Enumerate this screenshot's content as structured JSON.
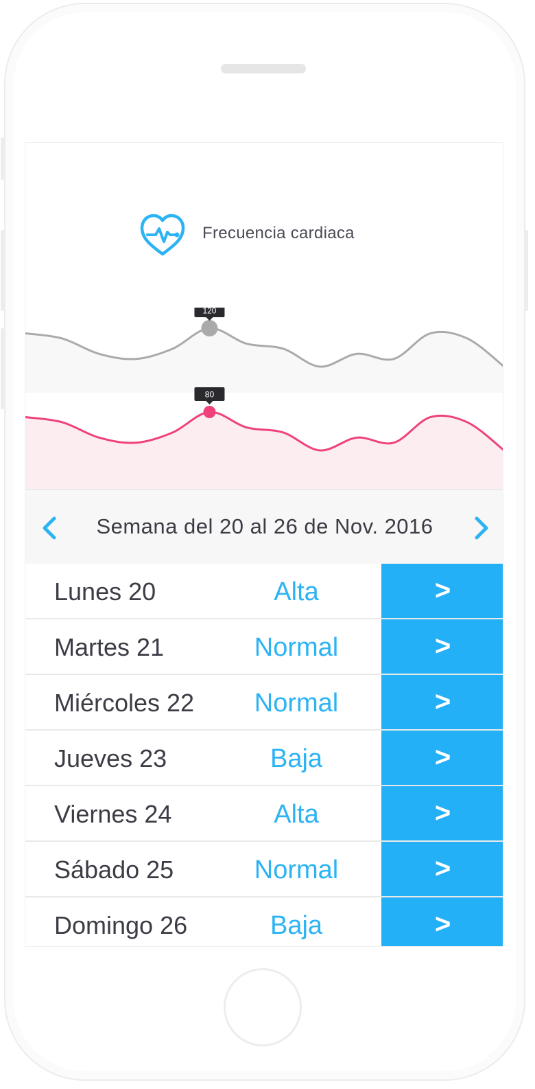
{
  "header": {
    "title": "Frecuencia cardiaca",
    "icon": "heart-pulse-icon",
    "accent_color": "#2cb3f4"
  },
  "chart_data": {
    "type": "area",
    "series": [
      {
        "values": [
          118,
          116,
          110,
          108,
          112,
          120,
          114,
          112,
          105,
          110,
          108,
          118,
          116,
          105
        ],
        "color": "#aaaaaa",
        "highlight": {
          "index": 5,
          "label": "120"
        }
      },
      {
        "values": [
          78,
          76,
          70,
          68,
          72,
          80,
          74,
          72,
          65,
          70,
          68,
          78,
          76,
          65
        ],
        "color": "#f0427a",
        "highlight": {
          "index": 5,
          "label": "80"
        }
      }
    ]
  },
  "week": {
    "label": "Semana del 20 al 26 de Nov. 2016",
    "prev_icon": "chevron-left-icon",
    "next_icon": "chevron-right-icon"
  },
  "days": [
    {
      "name": "Lunes 20",
      "level": "Alta",
      "action": ">"
    },
    {
      "name": "Martes 21",
      "level": "Normal",
      "action": ">"
    },
    {
      "name": "Miércoles 22",
      "level": "Normal",
      "action": ">"
    },
    {
      "name": "Jueves 23",
      "level": "Baja",
      "action": ">"
    },
    {
      "name": "Viernes 24",
      "level": "Alta",
      "action": ">"
    },
    {
      "name": "Sábado 25",
      "level": "Normal",
      "action": ">"
    },
    {
      "name": "Domingo 26",
      "level": "Baja",
      "action": ">"
    }
  ]
}
